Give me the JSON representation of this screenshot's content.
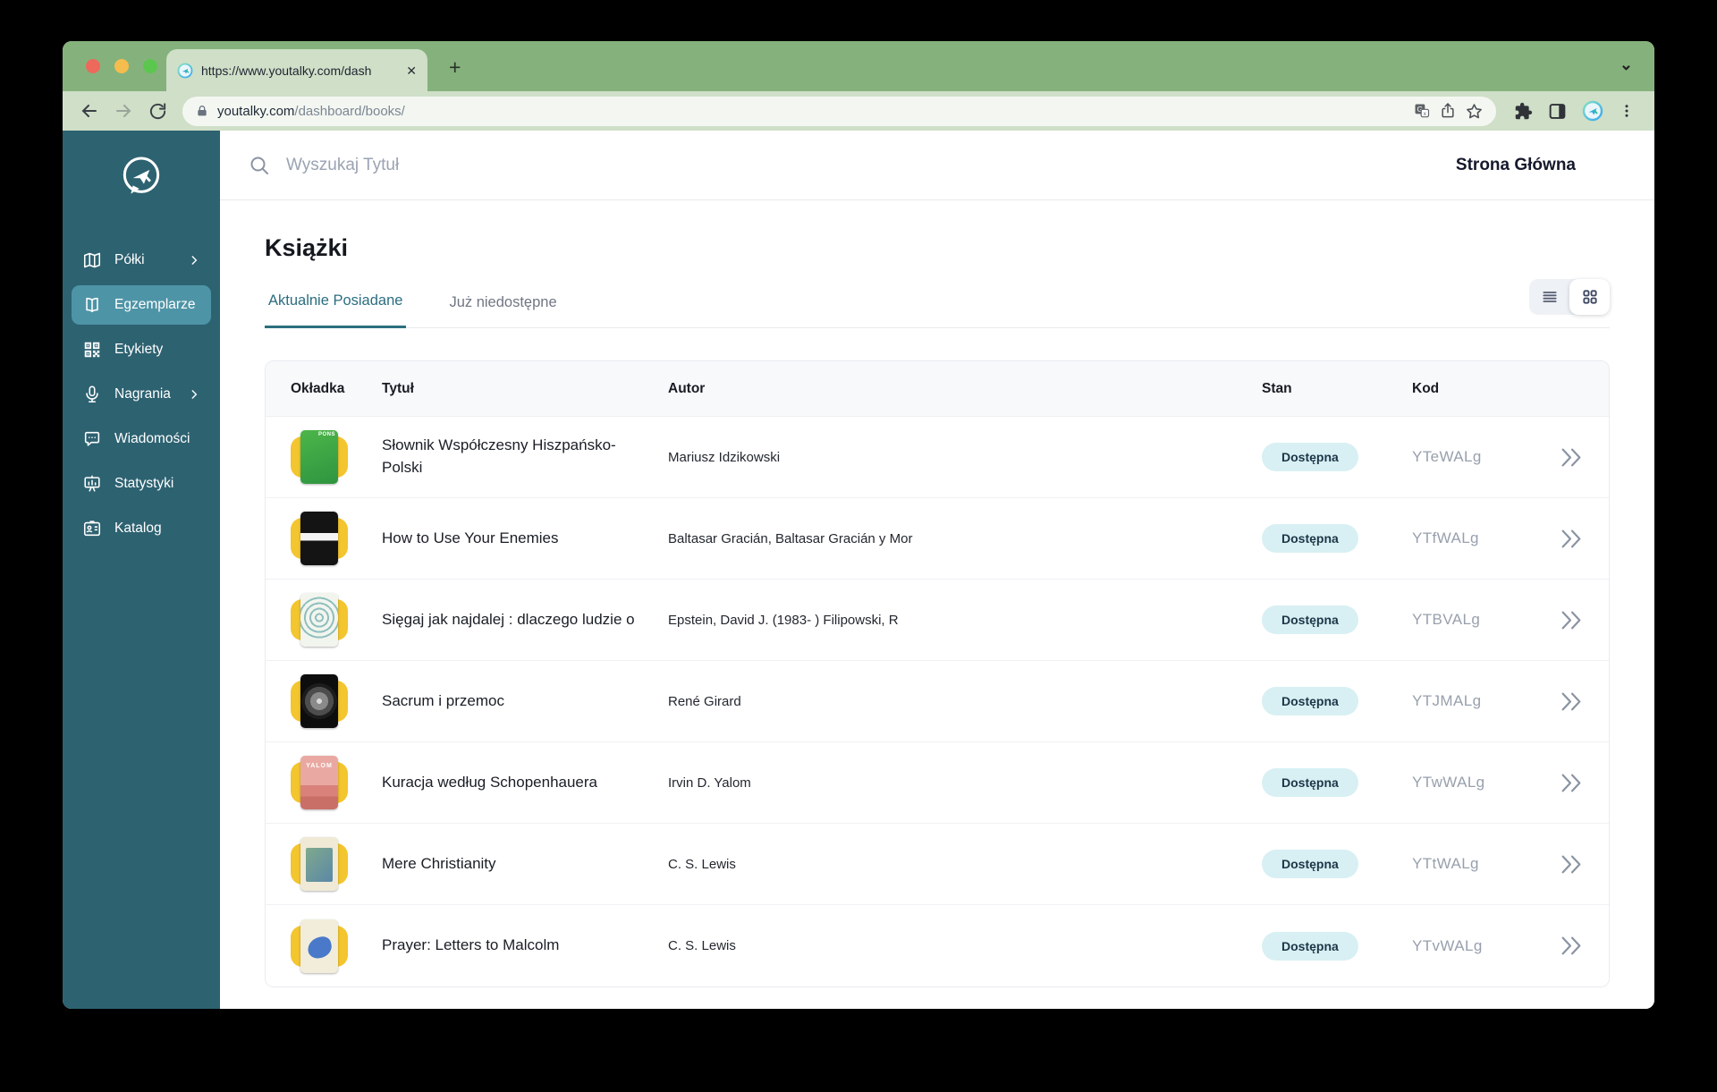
{
  "browser": {
    "tab_title": "https://www.youtalky.com/dash",
    "tab_close": "✕",
    "new_tab": "+",
    "tab_strip_chevron": "⌄",
    "url_domain": "youtalky.com",
    "url_path": "/dashboard/books/"
  },
  "sidebar": {
    "items": [
      {
        "label": "Półki",
        "icon": "map-icon",
        "has_chevron": true
      },
      {
        "label": "Egzemplarze",
        "icon": "open-book-icon",
        "active": true
      },
      {
        "label": "Etykiety",
        "icon": "qr-code-icon"
      },
      {
        "label": "Nagrania",
        "icon": "microphone-icon",
        "has_chevron": true
      },
      {
        "label": "Wiadomości",
        "icon": "chat-bubble-icon"
      },
      {
        "label": "Statystyki",
        "icon": "chart-board-icon"
      },
      {
        "label": "Katalog",
        "icon": "id-card-icon"
      }
    ]
  },
  "header": {
    "search_placeholder": "Wyszukaj Tytuł",
    "home_link": "Strona Główna"
  },
  "page": {
    "title": "Książki",
    "tabs": [
      {
        "label": "Aktualnie Posiadane",
        "active": true
      },
      {
        "label": "Już niedostępne",
        "active": false
      }
    ]
  },
  "table": {
    "columns": [
      "Okładka",
      "Tytuł",
      "Autor",
      "Stan",
      "Kod"
    ],
    "rows": [
      {
        "title": "Słownik Współczesny Hiszpańsko-Polski",
        "author": "Mariusz Idzikowski",
        "status": "Dostępna",
        "code": "YTeWALg",
        "cover": "green",
        "cover_label": "PONS"
      },
      {
        "title": "How to Use Your Enemies",
        "author": "Baltasar Gracián, Baltasar Gracián y Mor",
        "status": "Dostępna",
        "code": "YTfWALg",
        "cover": "black-band",
        "cover_label": ""
      },
      {
        "title": "Sięgaj jak najdalej : dlaczego ludzie o",
        "author": "Epstein, David J. (1983- ) Filipowski, R",
        "status": "Dostępna",
        "code": "YTBVALg",
        "cover": "rings",
        "cover_label": ""
      },
      {
        "title": "Sacrum i przemoc",
        "author": "René Girard",
        "status": "Dostępna",
        "code": "YTJMALg",
        "cover": "mandala",
        "cover_label": ""
      },
      {
        "title": "Kuracja według Schopenhauera",
        "author": "Irvin D. Yalom",
        "status": "Dostępna",
        "code": "YTwWALg",
        "cover": "salmon",
        "cover_label": "YALOM"
      },
      {
        "title": "Mere Christianity",
        "author": "C. S. Lewis",
        "status": "Dostępna",
        "code": "YTtWALg",
        "cover": "ornate",
        "cover_label": ""
      },
      {
        "title": "Prayer: Letters to Malcolm",
        "author": "C. S. Lewis",
        "status": "Dostępna",
        "code": "YTvWALg",
        "cover": "bird",
        "cover_label": ""
      }
    ]
  },
  "colors": {
    "tabbar_green": "#85B27C",
    "toolbar_green": "#CFDFC8",
    "sidebar_teal": "#2D6271",
    "sidebar_active": "#4E94A7",
    "accent_teal": "#2C6E80",
    "badge_bg": "#D8F0F3",
    "cover_backing_yellow": "#F3C52F"
  }
}
